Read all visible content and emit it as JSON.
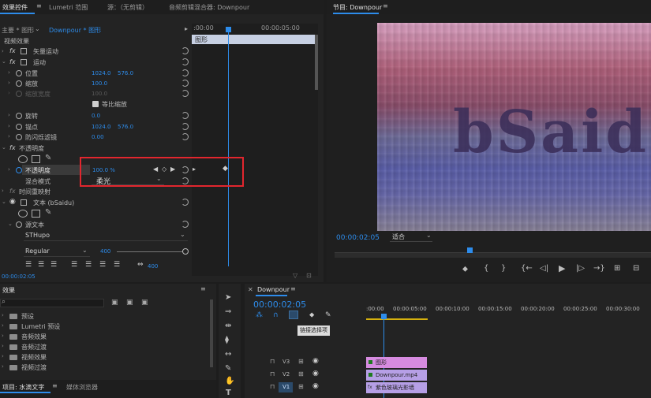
{
  "effect_controls": {
    "tabs": [
      "效果控件",
      "Lumetri 范围",
      "源：（无剪辑）",
      "音频剪辑混合器: Downpour"
    ],
    "master": "主要 * 图形",
    "sequence": "Downpour * 图形",
    "timecode_start": ":00:00",
    "timecode_end": "00:00:05:00",
    "clip_label": "图形",
    "video_effects": "视频效果",
    "vector_motion": "矢量运动",
    "motion": "运动",
    "position": "位置",
    "position_x": "1024.0",
    "position_y": "576.0",
    "scale": "缩放",
    "scale_value": "100.0",
    "scale_width": "缩放宽度",
    "scale_width_value": "100.0",
    "uniform_scale": "等比缩放",
    "rotation": "旋转",
    "rotation_value": "0.0",
    "anchor": "锚点",
    "anchor_x": "1024.0",
    "anchor_y": "576.0",
    "anti_flicker": "防闪烁滤镜",
    "anti_flicker_value": "0.00",
    "opacity_group": "不透明度",
    "opacity": "不透明度",
    "opacity_value": "100.0 %",
    "blend_mode": "混合模式",
    "blend_value": "柔光",
    "time_remap": "时间重映射",
    "text_layer": "文本 (bSaidu)",
    "source_text": "源文本",
    "font": "STHupo",
    "style": "Regular",
    "font_size": "400",
    "tracking": "400",
    "bottom_time": "00:00:02:05"
  },
  "program": {
    "title": "节目: Downpour",
    "overlay_text": "bSaid",
    "timecode": "00:00:02:05",
    "fit": "适合"
  },
  "effects_panel": {
    "title": "效果",
    "folders": [
      "预设",
      "Lumetri 预设",
      "音频效果",
      "音频过渡",
      "视频效果",
      "视频过渡"
    ],
    "project_tab": "项目: 水滴文字",
    "media_tab": "媒体浏览器"
  },
  "timeline": {
    "title": "Downpour",
    "timecode": "00:00:02:05",
    "tooltip": "链接选择项",
    "ruler": [
      ":00:00",
      "00:00:05:00",
      "00:00:10:00",
      "00:00:15:00",
      "00:00:20:00",
      "00:00:25:00",
      "00:00:30:00"
    ],
    "tracks": [
      "V3",
      "V2",
      "V1"
    ],
    "clips": [
      {
        "name": "图形",
        "color": "#d68be0"
      },
      {
        "name": "Downpour.mp4",
        "color": "#b69fe6"
      },
      {
        "name": "紫色玻璃光影墙",
        "color": "#b69fe6"
      }
    ]
  },
  "colors": {
    "accent": "#2d8ceb",
    "highlight_box": "#e2262e"
  }
}
